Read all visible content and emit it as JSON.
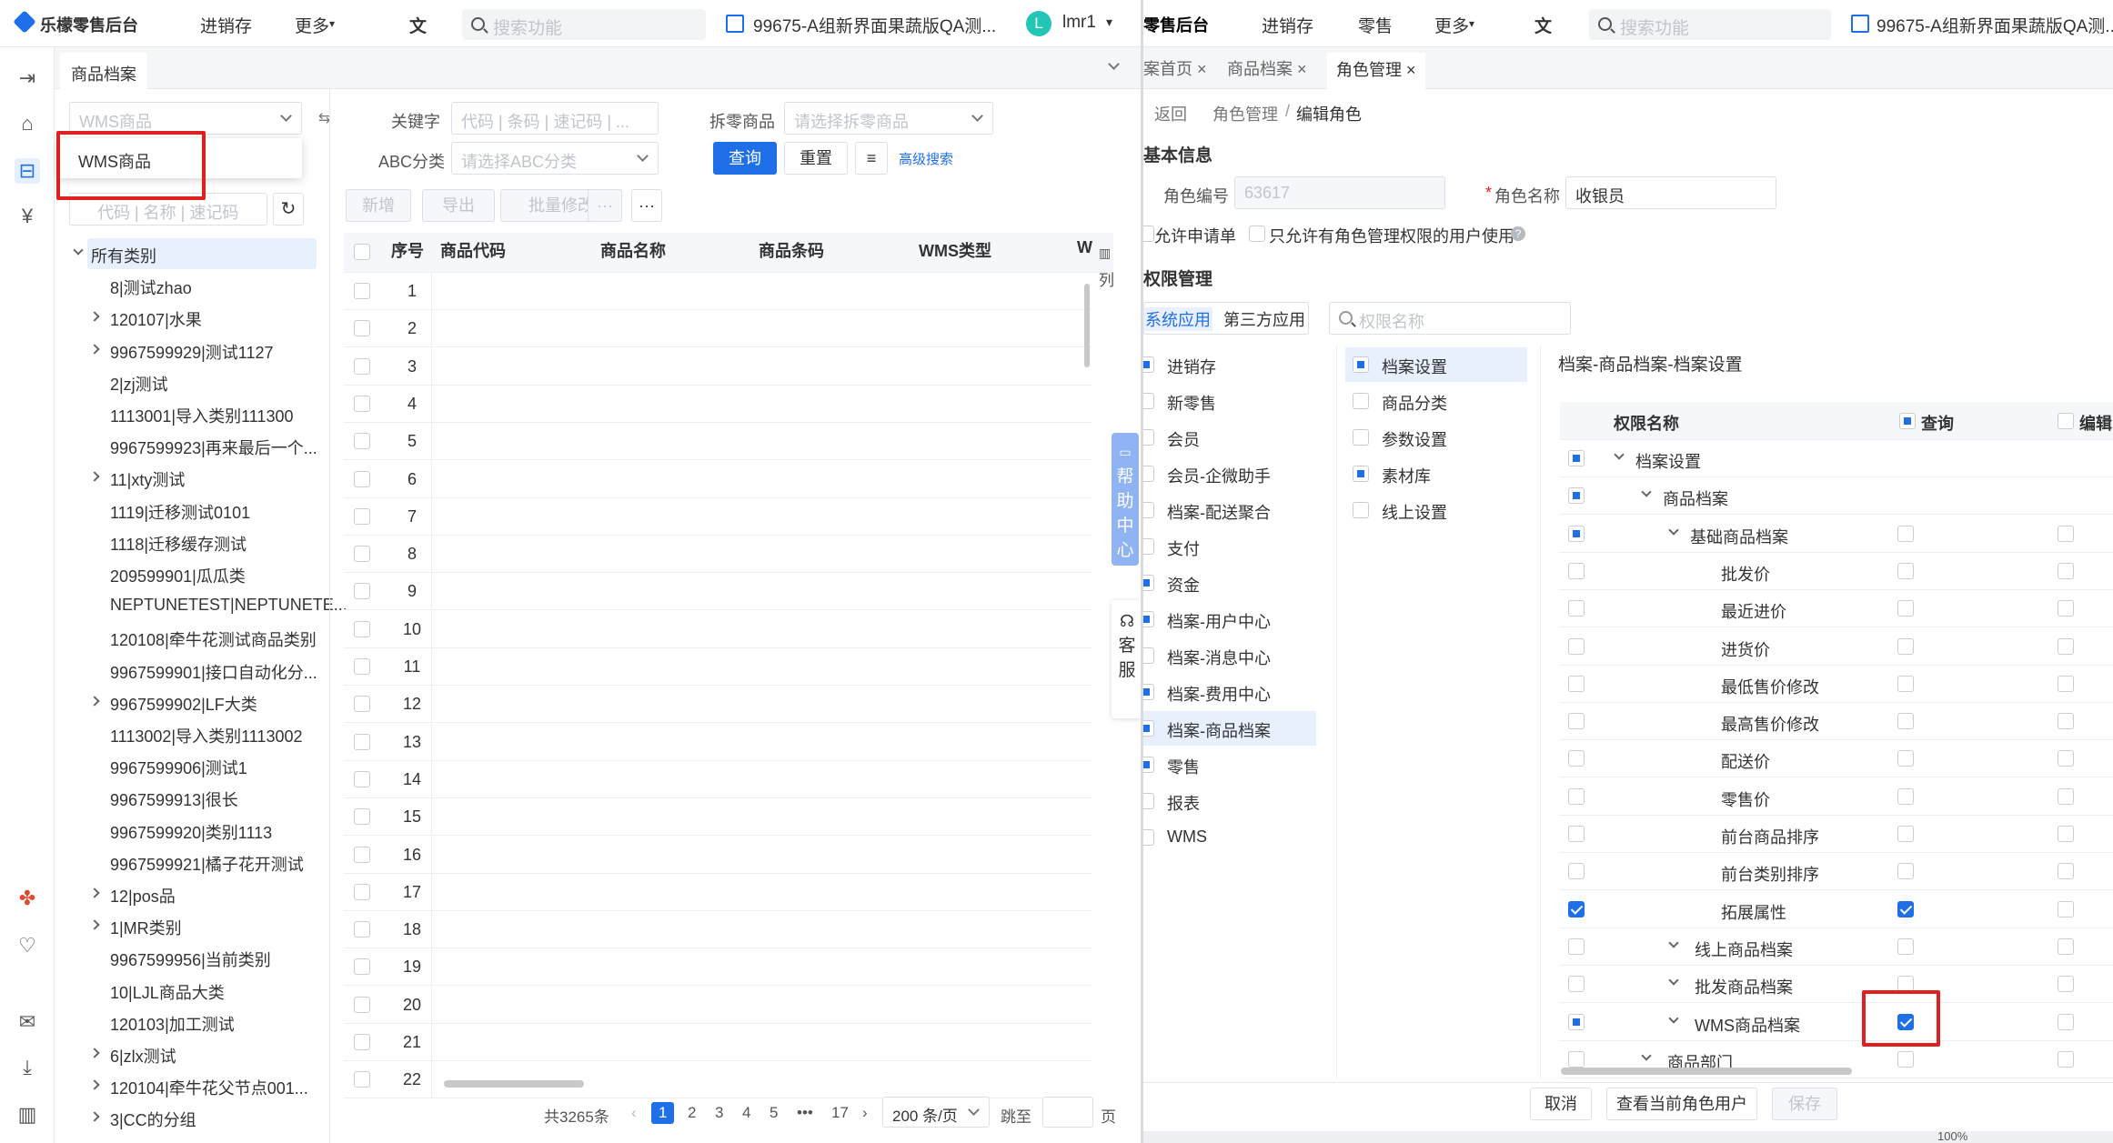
{
  "left": {
    "brand": "乐檬零售后台",
    "nav": [
      "进销存",
      "更多"
    ],
    "search_placeholder": "搜索功能",
    "store": "99675-A组新界面果蔬版QA测...",
    "user_initial": "L",
    "user": "lmr1",
    "page_tab": "商品档案",
    "goods_type_placeholder": "WMS商品",
    "dropdown_option": "WMS商品",
    "tree_search_placeholder": "代码 | 名称 | 速记码",
    "filters": {
      "keyword_label": "关键字",
      "keyword_placeholder": "代码 | 条码 | 速记码 | ...",
      "split_label": "拆零商品",
      "split_placeholder": "请选择拆零商品",
      "abc_label": "ABC分类",
      "abc_placeholder": "请选择ABC分类",
      "query": "查询",
      "reset": "重置",
      "advanced": "高级搜索"
    },
    "actions": {
      "add": "新增",
      "export": "导出",
      "batch": "批量修改"
    },
    "columns": [
      "序号",
      "商品代码",
      "商品名称",
      "商品条码",
      "WMS类型",
      "W"
    ],
    "col_label": "列",
    "rows": [
      "1",
      "2",
      "3",
      "4",
      "5",
      "6",
      "7",
      "8",
      "9",
      "10",
      "11",
      "12",
      "13",
      "14",
      "15",
      "16",
      "17",
      "18",
      "19",
      "20",
      "21",
      "22"
    ],
    "tree": [
      "所有类别",
      "8|测试zhao",
      "120107|水果",
      "9967599929|测试1127",
      "2|zj测试",
      "1113001|导入类别111300",
      "9967599923|再来最后一个...",
      "11|xty测试",
      "1119|迁移测试0101",
      "1118|迁移缓存测试",
      "209599901|瓜瓜类",
      "NEPTUNETEST|NEPTUNETE...",
      "120108|牵牛花测试商品类别",
      "9967599901|接口自动化分...",
      "9967599902|LF大类",
      "1113002|导入类别1113002",
      "9967599906|测试1",
      "9967599913|很长",
      "9967599920|类别1113",
      "9967599921|橘子花开测试",
      "12|pos品",
      "1|MR类别",
      "9967599956|当前类别",
      "10|LJL商品大类",
      "120103|加工测试",
      "6|zlx测试",
      "120104|牵牛花父节点001...",
      "3|CC的分组"
    ],
    "pagination": {
      "total": "共3265条",
      "pages": [
        "1",
        "2",
        "3",
        "4",
        "5",
        "•••",
        "17"
      ],
      "size": "200 条/页",
      "jump": "跳至",
      "page_unit": "页"
    },
    "help": "帮助中心",
    "service": "客服"
  },
  "right": {
    "brand_part": "零售后台",
    "nav": [
      "进销存",
      "零售",
      "更多"
    ],
    "search_placeholder": "搜索功能",
    "store": "99675-A组新界面果蔬版QA测...",
    "tabs": [
      "案首页",
      "商品档案",
      "角色管理"
    ],
    "breadcrumb": {
      "back": "返回",
      "parent": "角色管理",
      "sep": "/",
      "current": "编辑角色"
    },
    "basic_info": "基本信息",
    "role_no_label": "角色编号",
    "role_no": "63617",
    "role_name_label": "角色名称",
    "role_name": "收银员",
    "allow_apply": "允许申请单",
    "only_admin": "只允许有角色管理权限的用户使用",
    "perm_mgmt": "权限管理",
    "sys_tab": "系统应用",
    "third_tab": "第三方应用",
    "perm_search_placeholder": "权限名称",
    "modules": [
      "进销存",
      "新零售",
      "会员",
      "会员-企微助手",
      "档案-配送聚合",
      "支付",
      "资金",
      "档案-用户中心",
      "档案-消息中心",
      "档案-费用中心",
      "档案-商品档案",
      "零售",
      "报表",
      "WMS"
    ],
    "submodules": [
      "档案设置",
      "商品分类",
      "参数设置",
      "素材库",
      "线上设置"
    ],
    "perm_path": "档案-商品档案-档案设置",
    "perm_cols": [
      "权限名称",
      "查询",
      "编辑"
    ],
    "perms": [
      "档案设置",
      "商品档案",
      "基础商品档案",
      "批发价",
      "最近进价",
      "进货价",
      "最低售价修改",
      "最高售价修改",
      "配送价",
      "零售价",
      "前台商品排序",
      "前台类别排序",
      "拓展属性",
      "线上商品档案",
      "批发商品档案",
      "WMS商品档案",
      "商品部门"
    ],
    "footer": {
      "cancel": "取消",
      "view_users": "查看当前角色用户",
      "save": "保存"
    },
    "zoom": "100%"
  }
}
